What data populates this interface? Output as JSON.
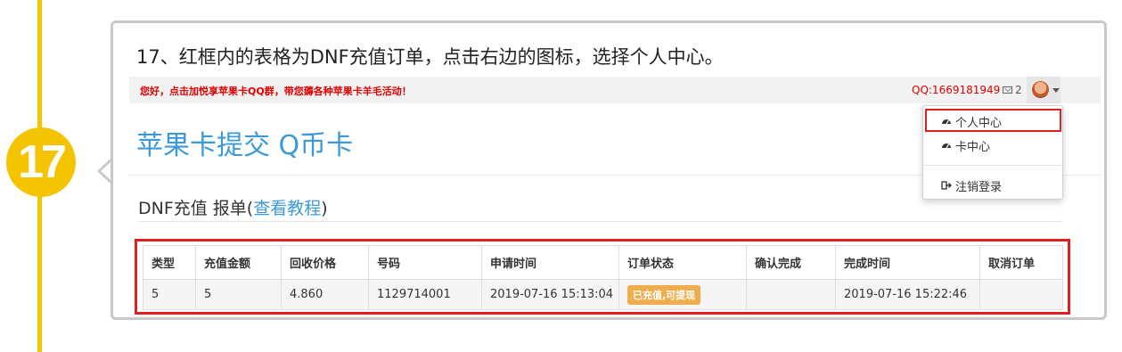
{
  "step": {
    "number": "17"
  },
  "caption": "17、红框内的表格为DNF充值订单，点击右边的图标，选择个人中心。",
  "topbar": {
    "promo": "您好，点击加悦享苹果卡QQ群，带您薅各种苹果卡羊毛活动！",
    "qq": "QQ:1669181949",
    "message_count": "2"
  },
  "brand": "苹果卡提交  Q币卡",
  "dropdown": {
    "items": [
      {
        "label": "个人中心",
        "icon": "dashboard-icon"
      },
      {
        "label": "卡中心",
        "icon": "dashboard-icon"
      },
      {
        "label": "注销登录",
        "icon": "sign-out-icon"
      }
    ]
  },
  "section": {
    "title": "DNF充值 报单(",
    "link": "查看教程",
    "close": ")"
  },
  "table": {
    "headers": [
      "类型",
      "充值金额",
      "回收价格",
      "号码",
      "申请时间",
      "订单状态",
      "确认完成",
      "完成时间",
      "取消订单"
    ],
    "rows": [
      [
        "5",
        "5",
        "4.860",
        "1129714001",
        "2019-07-16 15:13:04",
        "已充值,可提现",
        "",
        "2019-07-16 15:22:46",
        ""
      ]
    ]
  },
  "colors": {
    "accent_yellow": "#f5c400",
    "highlight_red": "#e02020",
    "link_blue": "#3a9ad9",
    "badge_orange": "#f0ad4e"
  }
}
